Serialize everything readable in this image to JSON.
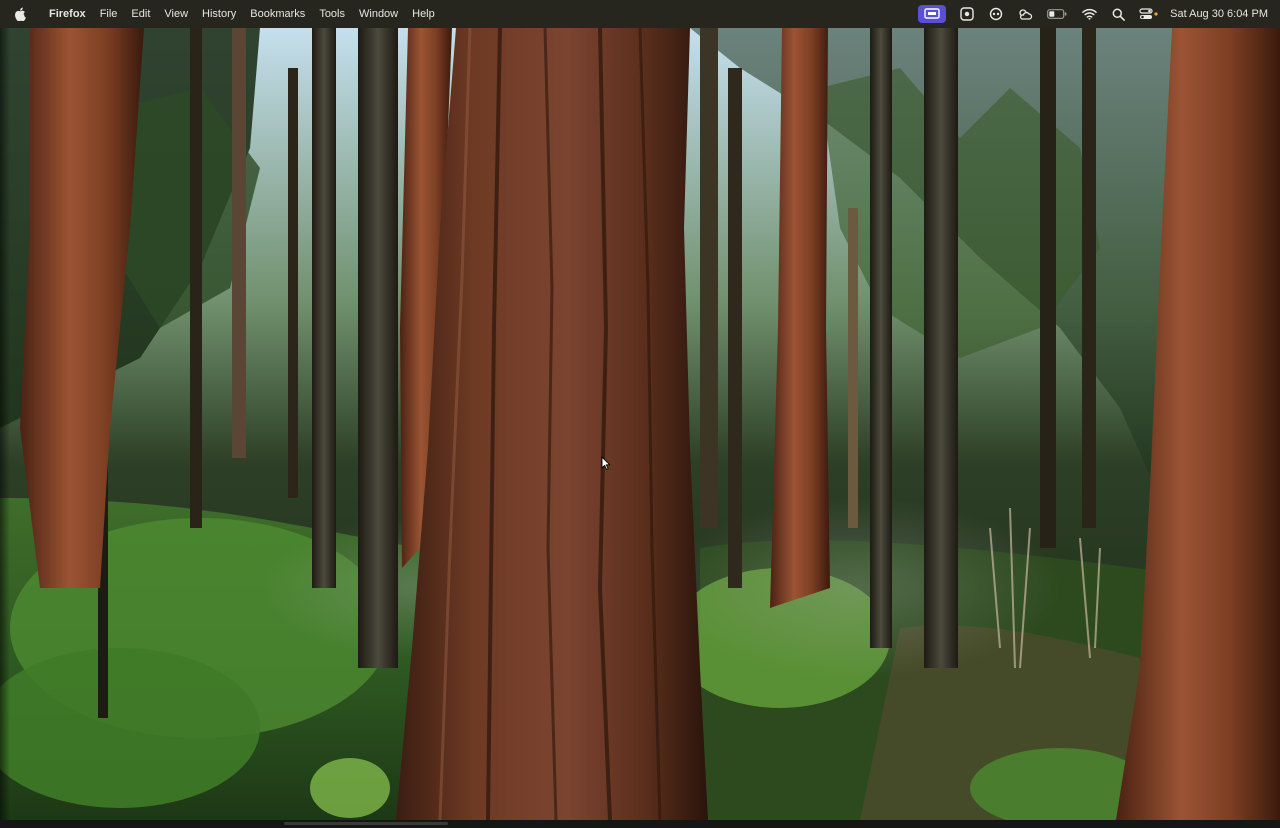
{
  "menubar": {
    "app_name": "Firefox",
    "items": [
      "File",
      "Edit",
      "View",
      "History",
      "Bookmarks",
      "Tools",
      "Window",
      "Help"
    ],
    "status_icons": [
      "screen-share-icon",
      "dashboard-icon",
      "copilot-icon",
      "weather-icon",
      "battery-icon",
      "wifi-icon",
      "spotlight-search-icon",
      "control-center-icon"
    ],
    "clock": "Sat Aug 30  6:04 PM",
    "accent_color": "#5b4fd8"
  },
  "content": {
    "scene": "forest-video-frame",
    "colors": {
      "sky": "#b9d6e8",
      "canopy": "#263a22",
      "trunk_red": "#7a3e24",
      "undergrowth": "#4f8d33"
    }
  }
}
